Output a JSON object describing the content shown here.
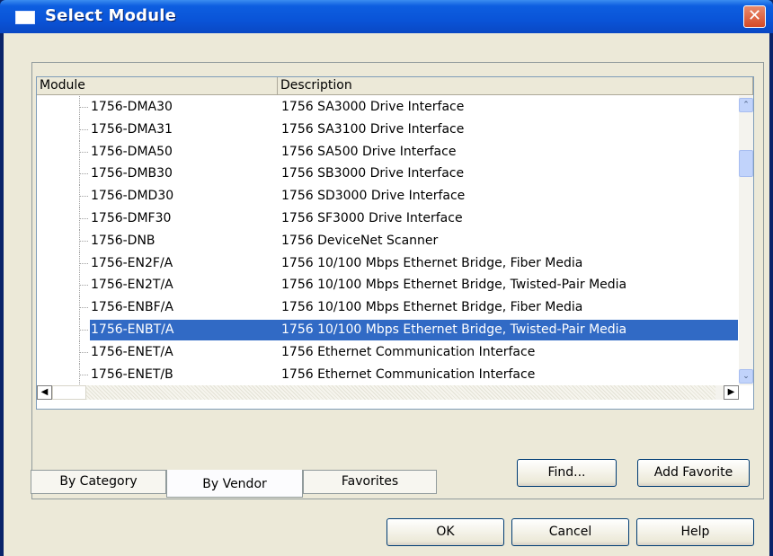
{
  "window": {
    "title": "Select Module",
    "close_glyph": "✕"
  },
  "list": {
    "columns": [
      "Module",
      "Description"
    ],
    "rows": [
      {
        "module": "1756-DMA30",
        "description": "1756 SA3000 Drive Interface"
      },
      {
        "module": "1756-DMA31",
        "description": "1756 SA3100 Drive Interface"
      },
      {
        "module": "1756-DMA50",
        "description": "1756 SA500 Drive Interface"
      },
      {
        "module": "1756-DMB30",
        "description": "1756 SB3000 Drive Interface"
      },
      {
        "module": "1756-DMD30",
        "description": "1756 SD3000 Drive Interface"
      },
      {
        "module": "1756-DMF30",
        "description": "1756 SF3000 Drive Interface"
      },
      {
        "module": "1756-DNB",
        "description": "1756 DeviceNet Scanner"
      },
      {
        "module": "1756-EN2F/A",
        "description": "1756 10/100 Mbps Ethernet Bridge, Fiber Media"
      },
      {
        "module": "1756-EN2T/A",
        "description": "1756 10/100 Mbps Ethernet Bridge, Twisted-Pair Media"
      },
      {
        "module": "1756-ENBF/A",
        "description": "1756 10/100 Mbps Ethernet Bridge, Fiber Media"
      },
      {
        "module": "1756-ENBT/A",
        "description": "1756 10/100 Mbps Ethernet Bridge, Twisted-Pair Media"
      },
      {
        "module": "1756-ENET/A",
        "description": "1756 Ethernet Communication Interface"
      },
      {
        "module": "1756-ENET/B",
        "description": "1756 Ethernet Communication Interface"
      }
    ],
    "selected_module": "1756-ENBT/A"
  },
  "scroll": {
    "up_glyph": "⌃",
    "down_glyph": "⌄",
    "left_glyph": "◀",
    "right_glyph": "▶"
  },
  "buttons": {
    "find": "Find...",
    "add_favorite": "Add Favorite",
    "ok": "OK",
    "cancel": "Cancel",
    "help": "Help"
  },
  "tabs": [
    {
      "label": "By Category",
      "active": false
    },
    {
      "label": "By Vendor",
      "active": true
    },
    {
      "label": "Favorites",
      "active": false
    }
  ],
  "colors": {
    "selection": "#316ac5",
    "titlebar": "#0a54d8",
    "dialog_bg": "#ece9d8"
  }
}
